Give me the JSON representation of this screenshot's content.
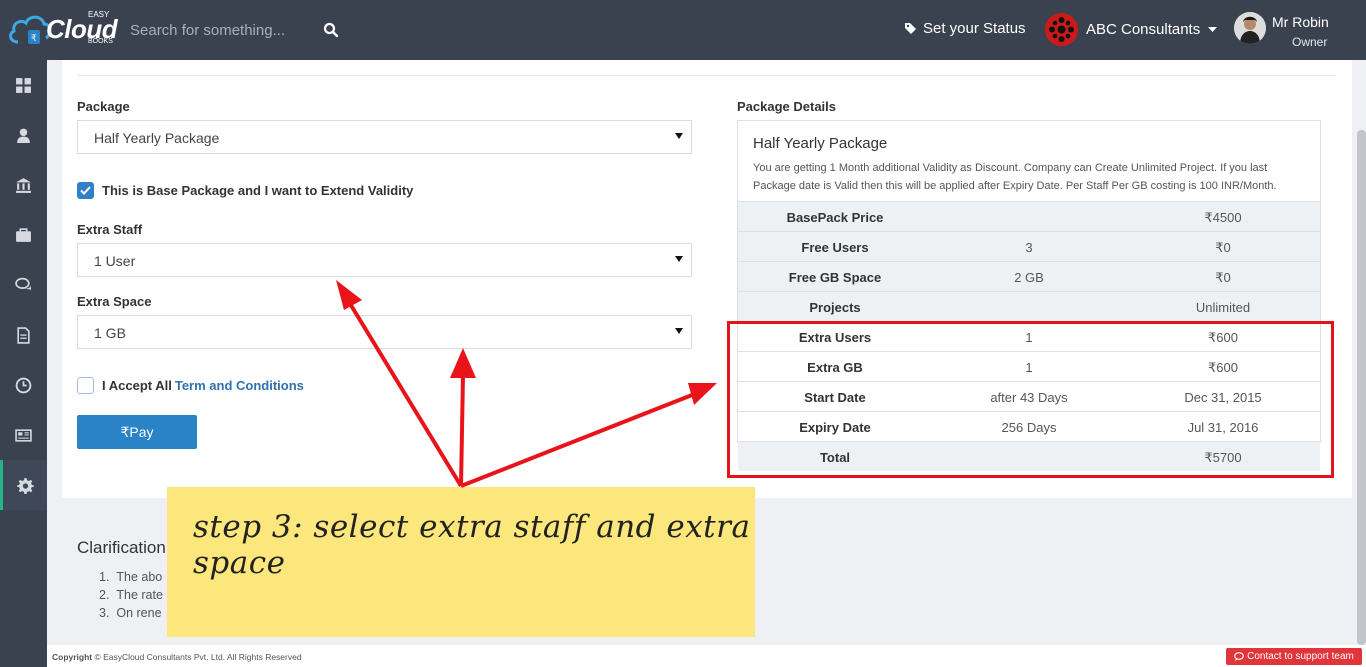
{
  "header": {
    "brand": "Cloud",
    "brand_top": "EASY",
    "brand_bottom": "BOOKS",
    "search_placeholder": "Search for something...",
    "status_label": "Set your Status",
    "company_name": "ABC Consultants",
    "user_name": "Mr Robin",
    "user_role": "Owner"
  },
  "sidebar": {
    "items": [
      {
        "icon": "dashboard-icon"
      },
      {
        "icon": "user-icon"
      },
      {
        "icon": "bank-icon"
      },
      {
        "icon": "briefcase-icon"
      },
      {
        "icon": "chat-icon"
      },
      {
        "icon": "document-icon"
      },
      {
        "icon": "clock-icon"
      },
      {
        "icon": "news-icon"
      },
      {
        "icon": "gear-icon",
        "active": true
      }
    ]
  },
  "form": {
    "package_label": "Package",
    "package_value": "Half Yearly Package",
    "base_checkbox_label": "This is Base Package and I want to Extend Validity",
    "base_checked": true,
    "extra_staff_label": "Extra Staff",
    "extra_staff_value": "1 User",
    "extra_space_label": "Extra Space",
    "extra_space_value": "1 GB",
    "accept_prefix": "I Accept All",
    "accept_link": "Term and Conditions",
    "accept_checked": false,
    "pay_label": "₹Pay"
  },
  "details": {
    "heading": "Package Details",
    "title": "Half Yearly Package",
    "description": "You are getting 1 Month additional Validity as Discount. Company can Create Unlimited Project. If you last Package date is Valid then this will be applied after Expiry Date. Per Staff Per GB costing is 100 INR/Month.",
    "rows": [
      {
        "label": "BasePack Price",
        "mid": "",
        "value": "₹4500"
      },
      {
        "label": "Free Users",
        "mid": "3",
        "value": "₹0"
      },
      {
        "label": "Free GB Space",
        "mid": "2 GB",
        "value": "₹0"
      },
      {
        "label": "Projects",
        "mid": "",
        "value": "Unlimited"
      },
      {
        "label": "Extra Users",
        "mid": "1",
        "value": "₹600"
      },
      {
        "label": "Extra GB",
        "mid": "1",
        "value": "₹600"
      },
      {
        "label": "Start Date",
        "mid": "after 43 Days",
        "value": "Dec 31, 2015"
      },
      {
        "label": "Expiry Date",
        "mid": "256 Days",
        "value": "Jul 31, 2016"
      },
      {
        "label": "Total",
        "mid": "",
        "value": "₹5700"
      }
    ]
  },
  "clarification": {
    "title": "Clarification",
    "items": [
      "The abo",
      "The rate",
      "On rene"
    ]
  },
  "note": {
    "text": "step 3: select extra staff and extra space"
  },
  "footer": {
    "copyright_bold": "Copyright",
    "copyright_rest": "© EasyCloud Consultants Pvt. Ltd. All Rights Reserved",
    "support": "Contact to support team"
  },
  "colors": {
    "topbar": "#3a4250",
    "accent": "#2a83c6",
    "highlight": "#e0141a",
    "note": "#fbe77b",
    "active_sidebar": "#27b38a"
  }
}
